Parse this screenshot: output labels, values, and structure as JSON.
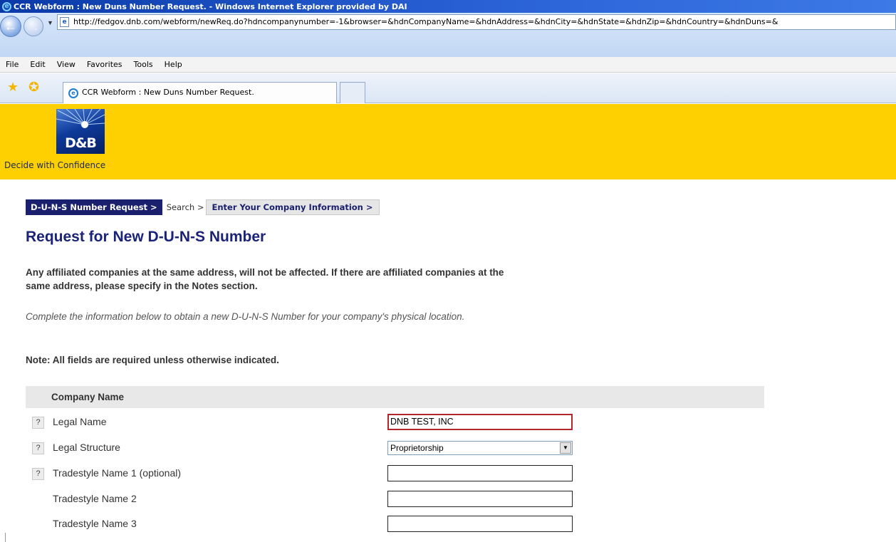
{
  "window": {
    "title": "CCR Webform : New Duns Number Request. - Windows Internet Explorer provided by DAI",
    "url": "http://fedgov.dnb.com/webform/newReq.do?hdncompanynumber=-1&browser=&hdnCompanyName=&hdnAddress=&hdnCity=&hdnState=&hdnZip=&hdnCountry=&hdnDuns=&"
  },
  "menu": [
    "File",
    "Edit",
    "View",
    "Favorites",
    "Tools",
    "Help"
  ],
  "tab": {
    "title": "CCR Webform : New Duns Number Request."
  },
  "brand": {
    "logo": "D&B",
    "tagline": "Decide with Confidence",
    "bar_color": "#fecf01"
  },
  "breadcrumb": [
    "D-U-N-S Number Request >",
    "Search >",
    "Enter Your Company Information >"
  ],
  "page": {
    "title": "Request for New D-U-N-S Number",
    "intro": "Any affiliated companies at the same address, will not be affected. If there are affiliated companies at the same address, please specify in the Notes section.",
    "italic_note": "Complete the information below to obtain a new D-U-N-S Number for your company's physical location.",
    "required_note": "Note: All fields are required unless otherwise indicated."
  },
  "section": {
    "title": "Company Name"
  },
  "fields": [
    {
      "label": "Legal Name",
      "value": "DNB TEST, INC",
      "help": "?"
    },
    {
      "label": "Legal Structure",
      "value": "Proprietorship",
      "help": "?"
    },
    {
      "label": "Tradestyle Name 1 (optional)",
      "value": "",
      "help": "?"
    },
    {
      "label": "Tradestyle Name 2",
      "value": ""
    },
    {
      "label": "Tradestyle Name 3",
      "value": ""
    }
  ]
}
